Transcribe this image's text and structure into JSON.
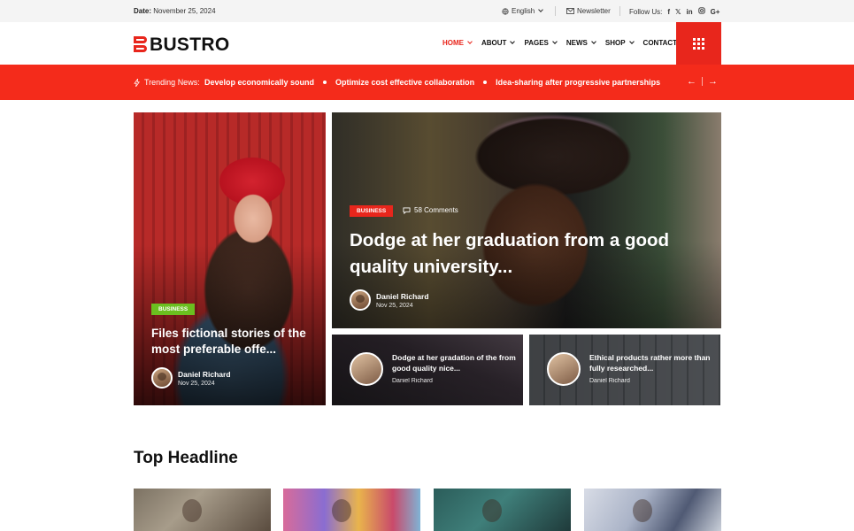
{
  "topbar": {
    "date_label": "Date:",
    "date_value": "November 25, 2024",
    "language": "English",
    "newsletter": "Newsletter",
    "follow_label": "Follow Us:",
    "social": [
      "f",
      "𝕏",
      "in",
      "ig",
      "G+"
    ]
  },
  "brand": {
    "name": "BUSTRO",
    "accent": "#e8261c"
  },
  "nav": [
    {
      "label": "HOME",
      "dropdown": true,
      "active": true
    },
    {
      "label": "ABOUT",
      "dropdown": true
    },
    {
      "label": "PAGES",
      "dropdown": true
    },
    {
      "label": "NEWS",
      "dropdown": true
    },
    {
      "label": "SHOP",
      "dropdown": true
    },
    {
      "label": "CONTACT",
      "dropdown": false
    }
  ],
  "trending": {
    "label": "Trending News:",
    "items": [
      "Develop economically sound",
      "Optimize cost effective collaboration",
      "Idea-sharing after progressive partnerships"
    ],
    "bg": "#f42b1b"
  },
  "hero_left": {
    "tag": "BUSINESS",
    "title": "Files fictional stories of the most preferable offe...",
    "author": "Daniel Richard",
    "date": "Nov 25, 2024"
  },
  "hero_main": {
    "tag": "BUSINESS",
    "comments": "58 Comments",
    "title": "Dodge at her graduation from a good quality university...",
    "author": "Daniel Richard",
    "date": "Nov 25, 2024"
  },
  "small_cards": [
    {
      "title": "Dodge at her gradation of the from good quality nice...",
      "author": "Daniel Richard"
    },
    {
      "title": "Ethical products rather more than fully researched...",
      "author": "Daniel Richard"
    }
  ],
  "section": {
    "title": "Top Headline"
  }
}
